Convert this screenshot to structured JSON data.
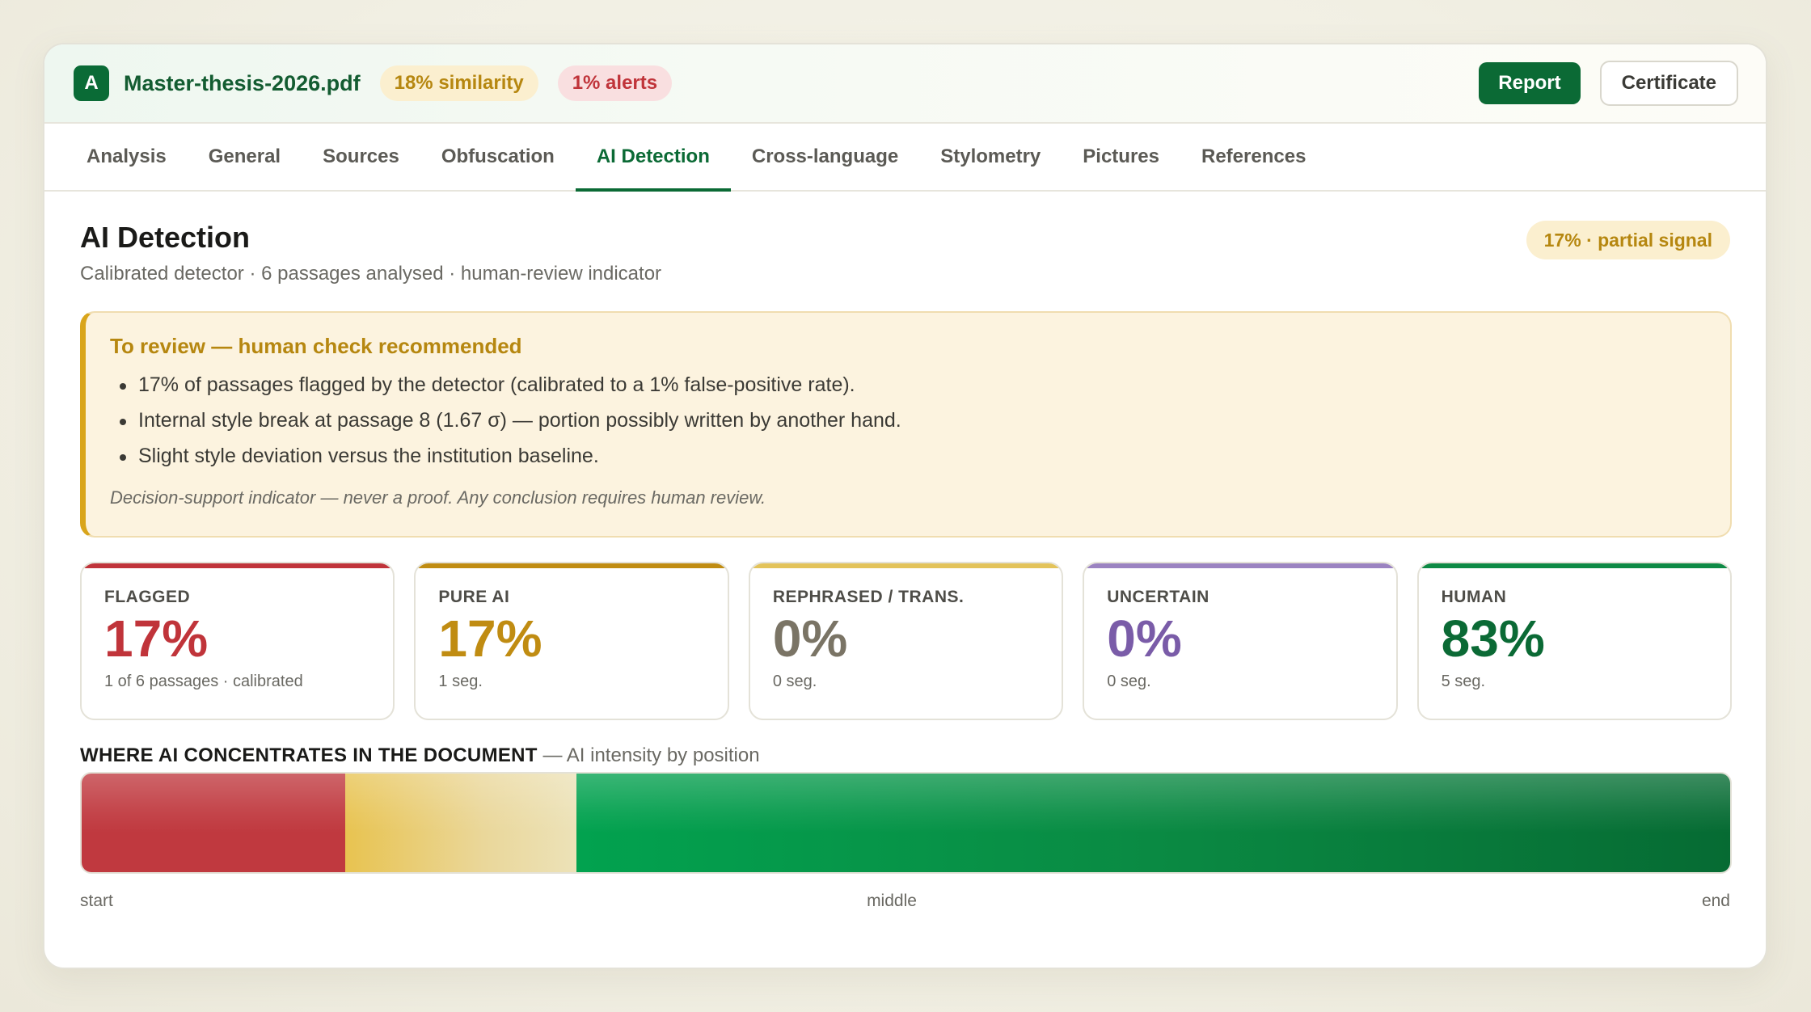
{
  "header": {
    "logo_letter": "A",
    "filename": "Master-thesis-2026.pdf",
    "similarity_pill": "18% similarity",
    "alerts_pill": "1% alerts",
    "report_label": "Report",
    "certificate_label": "Certificate"
  },
  "tabs": [
    {
      "label": "Analysis",
      "active": false
    },
    {
      "label": "General",
      "active": false
    },
    {
      "label": "Sources",
      "active": false
    },
    {
      "label": "Obfuscation",
      "active": false
    },
    {
      "label": "AI Detection",
      "active": true
    },
    {
      "label": "Cross-language",
      "active": false
    },
    {
      "label": "Stylometry",
      "active": false
    },
    {
      "label": "Pictures",
      "active": false
    },
    {
      "label": "References",
      "active": false
    }
  ],
  "page": {
    "title": "AI Detection",
    "subtitle": "Calibrated detector · 6 passages analysed · human-review indicator",
    "signal_pill": "17% · partial signal"
  },
  "review": {
    "title": "To review — human check recommended",
    "items": [
      "17% of passages flagged by the detector (calibrated to a 1% false-positive rate).",
      "Internal style break at passage 8 (1.67 σ) — portion possibly written by another hand.",
      "Slight style deviation versus the institution baseline."
    ],
    "note": "Decision-support indicator — never a proof. Any conclusion requires human review."
  },
  "stats": [
    {
      "label": "FLAGGED",
      "value": "17%",
      "sub": "1 of 6 passages · calibrated",
      "color": "#c0343a"
    },
    {
      "label": "PURE AI",
      "value": "17%",
      "sub": "1 seg.",
      "color": "#c08c12"
    },
    {
      "label": "REPHRASED / TRANS.",
      "value": "0%",
      "sub": "0 seg.",
      "color": "#7a7465",
      "bar": "#e3c35a"
    },
    {
      "label": "UNCERTAIN",
      "value": "0%",
      "sub": "0 seg.",
      "color": "#7a5ca8",
      "bar": "#9b83c1"
    },
    {
      "label": "HUMAN",
      "value": "83%",
      "sub": "5 seg.",
      "color": "#0b6a35",
      "bar": "#0e8a45"
    }
  ],
  "distribution": {
    "heading": "WHERE AI CONCENTRATES IN THE DOCUMENT",
    "caption": "— AI intensity by position",
    "segments": [
      {
        "share": 0.16,
        "kind": "ai",
        "color": "#c0393f"
      },
      {
        "share": 0.14,
        "kind": "rephrased",
        "color": "#e6c35a"
      },
      {
        "share": 0.7,
        "kind": "human",
        "color": "#0b8a45"
      }
    ],
    "axis_start": "start",
    "axis_middle": "middle",
    "axis_end": "end"
  }
}
